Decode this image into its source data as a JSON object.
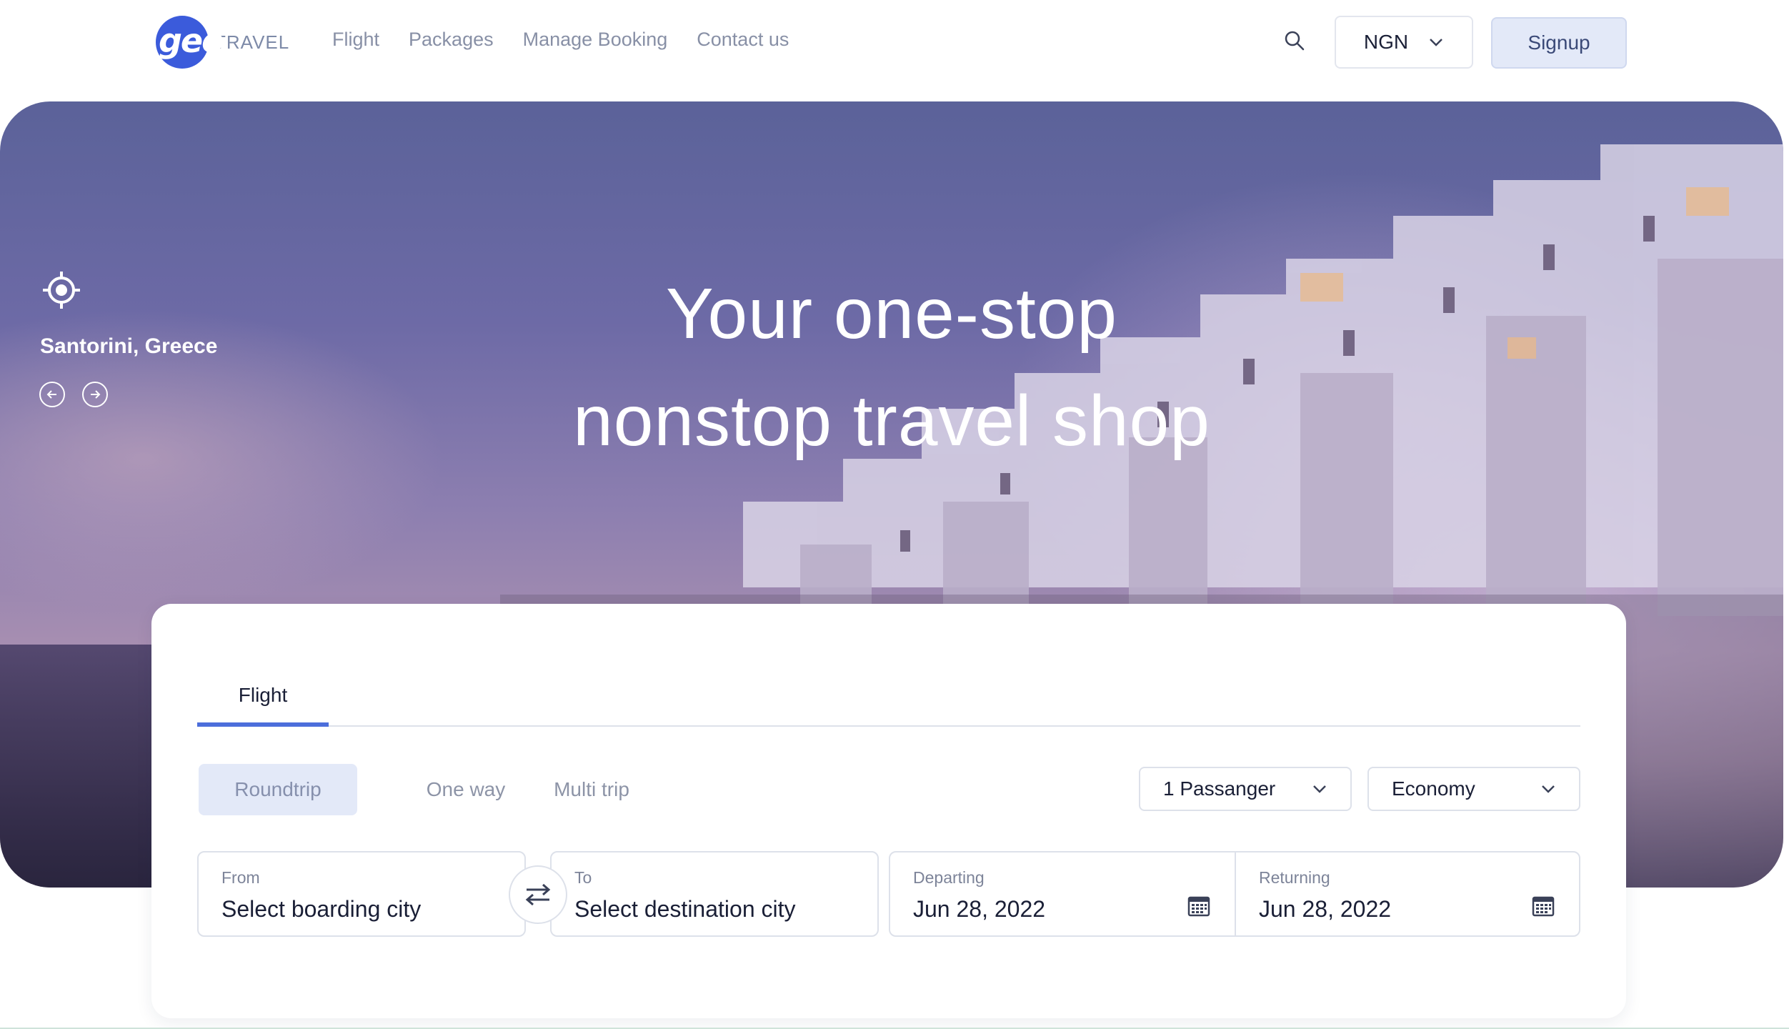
{
  "header": {
    "logo": {
      "mark": "geo",
      "text": "TRAVEL"
    },
    "nav": [
      "Flight",
      "Packages",
      "Manage Booking",
      "Contact us"
    ],
    "search_icon": "search-icon",
    "currency": "NGN",
    "signup": "Signup"
  },
  "hero": {
    "location": "Santorini, Greece",
    "headline_line1": "Your one-stop",
    "headline_line2": "nonstop travel shop"
  },
  "booking": {
    "tab": "Flight",
    "trip_types": [
      "Roundtrip",
      "One way",
      "Multi trip"
    ],
    "selected_trip_type": "Roundtrip",
    "passengers": "1 Passanger",
    "cabin_class": "Economy",
    "from": {
      "label": "From",
      "value": "Select boarding city"
    },
    "to": {
      "label": "To",
      "value": "Select destination city"
    },
    "departing": {
      "label": "Departing",
      "value": "Jun 28, 2022"
    },
    "returning": {
      "label": "Returning",
      "value": "Jun 28, 2022"
    }
  },
  "colors": {
    "accent": "#4c6edb",
    "brand_blue": "#3b5bdb",
    "signup_bg": "#e3e9f8",
    "nav_text": "#8890a6"
  }
}
